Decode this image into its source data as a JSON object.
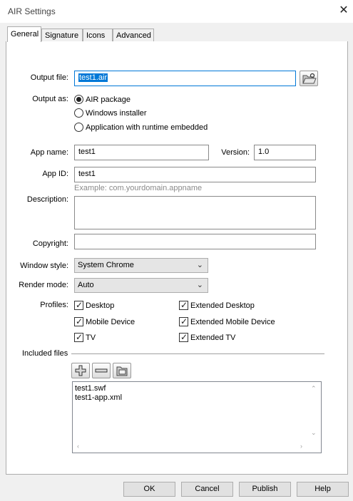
{
  "window": {
    "title": "AIR Settings",
    "close_icon": "close-icon"
  },
  "tabs": [
    {
      "label": "General",
      "active": true
    },
    {
      "label": "Signature",
      "active": false
    },
    {
      "label": "Icons",
      "active": false
    },
    {
      "label": "Advanced",
      "active": false
    }
  ],
  "general": {
    "output_file": {
      "label": "Output file:",
      "value": "test1.air",
      "browse_icon": "folder-icon"
    },
    "output_as": {
      "label": "Output as:",
      "options": [
        {
          "label": "AIR package",
          "selected": true
        },
        {
          "label": "Windows installer",
          "selected": false
        },
        {
          "label": "Application with runtime embedded",
          "selected": false
        }
      ]
    },
    "app_name": {
      "label": "App name:",
      "value": "test1"
    },
    "version": {
      "label": "Version:",
      "value": "1.0"
    },
    "app_id": {
      "label": "App ID:",
      "value": "test1",
      "hint": "Example: com.yourdomain.appname"
    },
    "description": {
      "label": "Description:",
      "value": ""
    },
    "copyright": {
      "label": "Copyright:",
      "value": ""
    },
    "window_style": {
      "label": "Window style:",
      "value": "System Chrome"
    },
    "render_mode": {
      "label": "Render mode:",
      "value": "Auto"
    },
    "profiles": {
      "label": "Profiles:",
      "items": [
        {
          "label": "Desktop",
          "checked": true
        },
        {
          "label": "Extended Desktop",
          "checked": true
        },
        {
          "label": "Mobile Device",
          "checked": true
        },
        {
          "label": "Extended Mobile Device",
          "checked": true
        },
        {
          "label": "TV",
          "checked": true
        },
        {
          "label": "Extended TV",
          "checked": true
        }
      ]
    },
    "included_files": {
      "label": "Included files",
      "add_icon": "plus-icon",
      "remove_icon": "minus-icon",
      "folder_icon": "folder-icon",
      "files": [
        "test1.swf",
        "test1-app.xml"
      ]
    }
  },
  "buttons": {
    "ok": "OK",
    "cancel": "Cancel",
    "publish": "Publish",
    "help": "Help"
  },
  "colors": {
    "accent": "#0078d7",
    "panel_bg": "#ffffff",
    "dialog_bg": "#f0f0f0"
  }
}
